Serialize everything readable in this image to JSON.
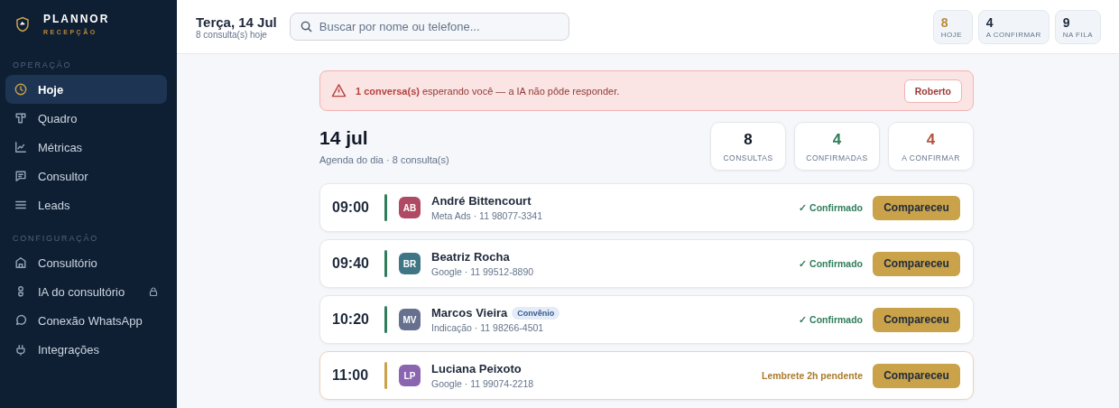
{
  "brand": {
    "name": "PLANNOR",
    "subtitle": "RECEPÇÃO"
  },
  "sidebar": {
    "sections": [
      {
        "label": "OPERAÇÃO",
        "items": [
          {
            "label": "Hoje",
            "selected": true,
            "locked": false
          },
          {
            "label": "Quadro",
            "selected": false,
            "locked": false
          },
          {
            "label": "Métricas",
            "selected": false,
            "locked": false
          },
          {
            "label": "Consultor",
            "selected": false,
            "locked": false
          },
          {
            "label": "Leads",
            "selected": false,
            "locked": false
          }
        ]
      },
      {
        "label": "CONFIGURAÇÃO",
        "items": [
          {
            "label": "Consultório",
            "selected": false,
            "locked": false
          },
          {
            "label": "IA do consultório",
            "selected": false,
            "locked": true
          },
          {
            "label": "Conexão WhatsApp",
            "selected": false,
            "locked": false
          },
          {
            "label": "Integrações",
            "selected": false,
            "locked": false
          }
        ]
      }
    ]
  },
  "header": {
    "title": "Terça, 14 Jul",
    "subtitle": "8 consulta(s) hoje",
    "search": {
      "placeholder": "Buscar por nome ou telefone..."
    },
    "stats": [
      {
        "value": "8",
        "label": "HOJE",
        "color": "#b8893a"
      },
      {
        "value": "4",
        "label": "A CONFIRMAR",
        "color": "#1e293b"
      },
      {
        "value": "9",
        "label": "NA FILA",
        "color": "#1e293b"
      }
    ]
  },
  "alert": {
    "text": "**1 conversa(s)** esperando você — a IA não pôde responder.",
    "button": "Roberto"
  },
  "day": {
    "title": "14 jul",
    "subtitle": "Agenda do dia · 8 consulta(s)",
    "stats": [
      {
        "value": "8",
        "label": "CONSULTAS",
        "color": "#111827"
      },
      {
        "value": "4",
        "label": "CONFIRMADAS",
        "color": "#2f7d5b"
      },
      {
        "value": "4",
        "label": "A CONFIRMAR",
        "color": "#b4533e"
      }
    ]
  },
  "appointments": [
    {
      "time": "09:00",
      "initials": "AB",
      "color": "#b04a62",
      "name": "André Bittencourt",
      "detail": "Meta Ads · 11 98077-3341",
      "kind": "confirmed",
      "status": "✓ Confirmado",
      "action": "Compareceu"
    },
    {
      "time": "09:40",
      "initials": "BR",
      "color": "#3f7686",
      "name": "Beatriz Rocha",
      "detail": "Google · 11 99512-8890",
      "kind": "confirmed",
      "status": "✓ Confirmado",
      "action": "Compareceu"
    },
    {
      "time": "10:20",
      "initials": "MV",
      "color": "#66708f",
      "name": "Marcos Vieira",
      "tag": "Convênio",
      "detail": "Indicação · 11 98266-4501",
      "kind": "confirmed",
      "status": "✓ Confirmado",
      "action": "Compareceu"
    },
    {
      "time": "11:00",
      "initials": "LP",
      "color": "#8b65b0",
      "name": "Luciana Peixoto",
      "detail": "Google · 11 99074-2218",
      "kind": "pending",
      "status": "Lembrete 2h pendente",
      "action": "Compareceu"
    }
  ]
}
